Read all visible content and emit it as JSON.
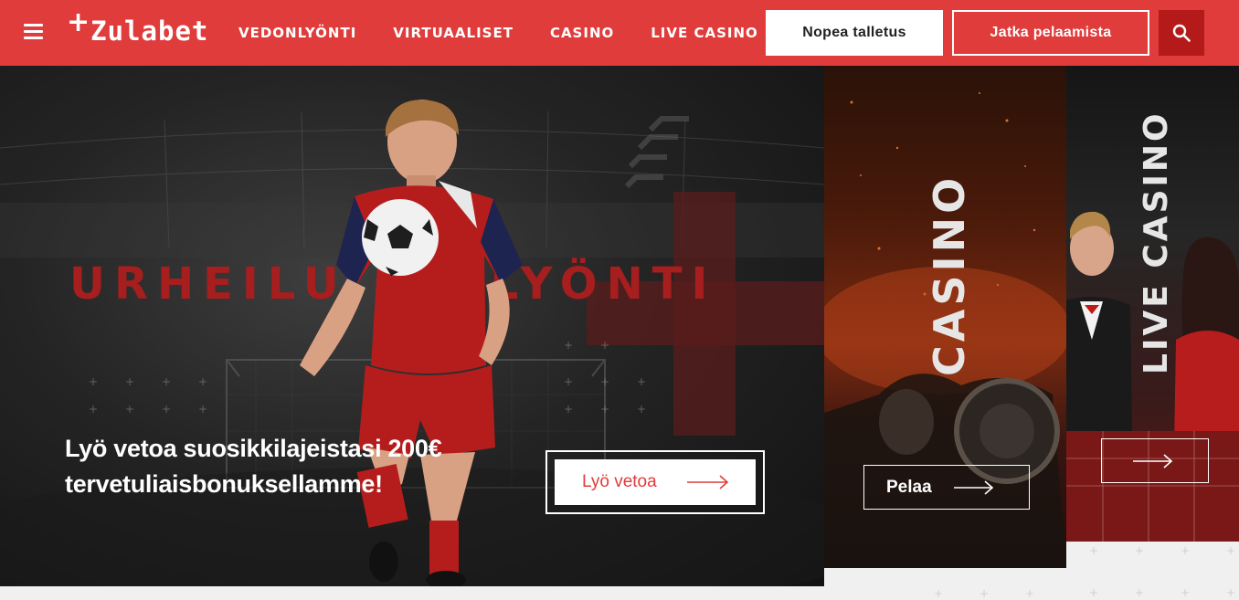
{
  "header": {
    "logo": "+Zulabet",
    "logo_plus": "+",
    "logo_word": "Zulabet",
    "nav": [
      "VEDONLYÖNTI",
      "VIRTUAALISET",
      "CASINO",
      "LIVE CASINO"
    ],
    "deposit_label": "Nopea talletus",
    "continue_label": "Jatka pelaamista",
    "menu_icon": "hamburger-icon",
    "search_icon": "search-icon"
  },
  "hero": {
    "title": "URHEILUVEDONLYÖNTI",
    "title_visible_left": "URHEILU",
    "title_visible_right": "LYÖNTI",
    "text": "Lyö vetoa suosikkilajeistasi 200€ tervetuliaisbonuksellamme!",
    "cta_label": "Lyö vetoa",
    "cta_icon": "arrow-right-icon"
  },
  "casino_card": {
    "title": "CASINO",
    "cta_label": "Pelaa",
    "cta_icon": "arrow-right-icon"
  },
  "live_casino_card": {
    "title": "LIVE CASINO",
    "cta_icon": "arrow-right-icon"
  },
  "colors": {
    "brand_red": "#e03c3c",
    "dark_red": "#b51a1a",
    "hero_title_red": "#a61e1e"
  }
}
